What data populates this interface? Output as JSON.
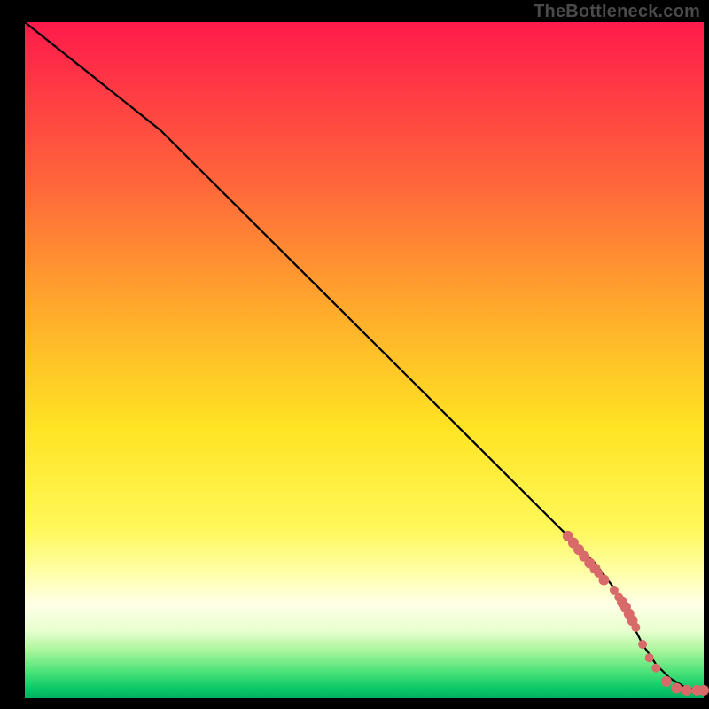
{
  "watermark": "TheBottleneck.com",
  "chart_data": {
    "type": "line",
    "title": "",
    "xlabel": "",
    "ylabel": "",
    "xlim": [
      0,
      100
    ],
    "ylim": [
      0,
      100
    ],
    "legend": null,
    "grid": false,
    "background_gradient": {
      "stops": [
        {
          "offset": 0.0,
          "color": "#ff1a4b"
        },
        {
          "offset": 0.25,
          "color": "#ff6a3a"
        },
        {
          "offset": 0.45,
          "color": "#ffb32a"
        },
        {
          "offset": 0.6,
          "color": "#ffe423"
        },
        {
          "offset": 0.75,
          "color": "#fff85a"
        },
        {
          "offset": 0.82,
          "color": "#ffffb0"
        },
        {
          "offset": 0.86,
          "color": "#ffffe6"
        },
        {
          "offset": 0.9,
          "color": "#e8ffd0"
        },
        {
          "offset": 0.93,
          "color": "#a8f59a"
        },
        {
          "offset": 0.96,
          "color": "#4de37a"
        },
        {
          "offset": 0.985,
          "color": "#0cc868"
        },
        {
          "offset": 1.0,
          "color": "#00b060"
        }
      ]
    },
    "series": [
      {
        "name": "bottleneck-curve",
        "type": "line",
        "color": "#000000",
        "x": [
          0,
          5,
          10,
          15,
          20,
          25,
          28,
          32,
          38,
          44,
          50,
          56,
          62,
          68,
          74,
          80,
          84,
          87,
          89.5,
          91,
          93,
          95,
          97,
          99,
          100
        ],
        "y": [
          100,
          96,
          92,
          88,
          84,
          79,
          76,
          72,
          66,
          60,
          54,
          48,
          42,
          36,
          30,
          24,
          20,
          16,
          11,
          8,
          5,
          3,
          1.8,
          1.2,
          1.2
        ]
      },
      {
        "name": "observed-points",
        "type": "scatter",
        "color": "#d96a6a",
        "x": [
          80.0,
          80.8,
          81.6,
          82.4,
          83.2,
          84.0,
          84.5,
          85.3,
          86.8,
          87.5,
          88.0,
          88.5,
          89.0,
          89.5,
          90.0,
          91.0,
          92.0,
          93.0,
          94.5,
          96.0,
          97.5,
          99.0,
          100.0
        ],
        "y": [
          24.0,
          23.0,
          22.0,
          21.0,
          20.0,
          19.2,
          18.5,
          17.5,
          16.0,
          15.0,
          14.2,
          13.5,
          12.5,
          11.5,
          10.5,
          8.0,
          6.0,
          4.5,
          2.5,
          1.5,
          1.2,
          1.2,
          1.2
        ],
        "r": [
          6,
          6,
          6,
          6,
          6,
          6,
          5,
          6,
          5,
          5,
          6,
          6,
          6,
          6,
          5,
          5,
          5,
          5,
          6,
          6,
          6,
          6,
          6
        ]
      }
    ]
  }
}
